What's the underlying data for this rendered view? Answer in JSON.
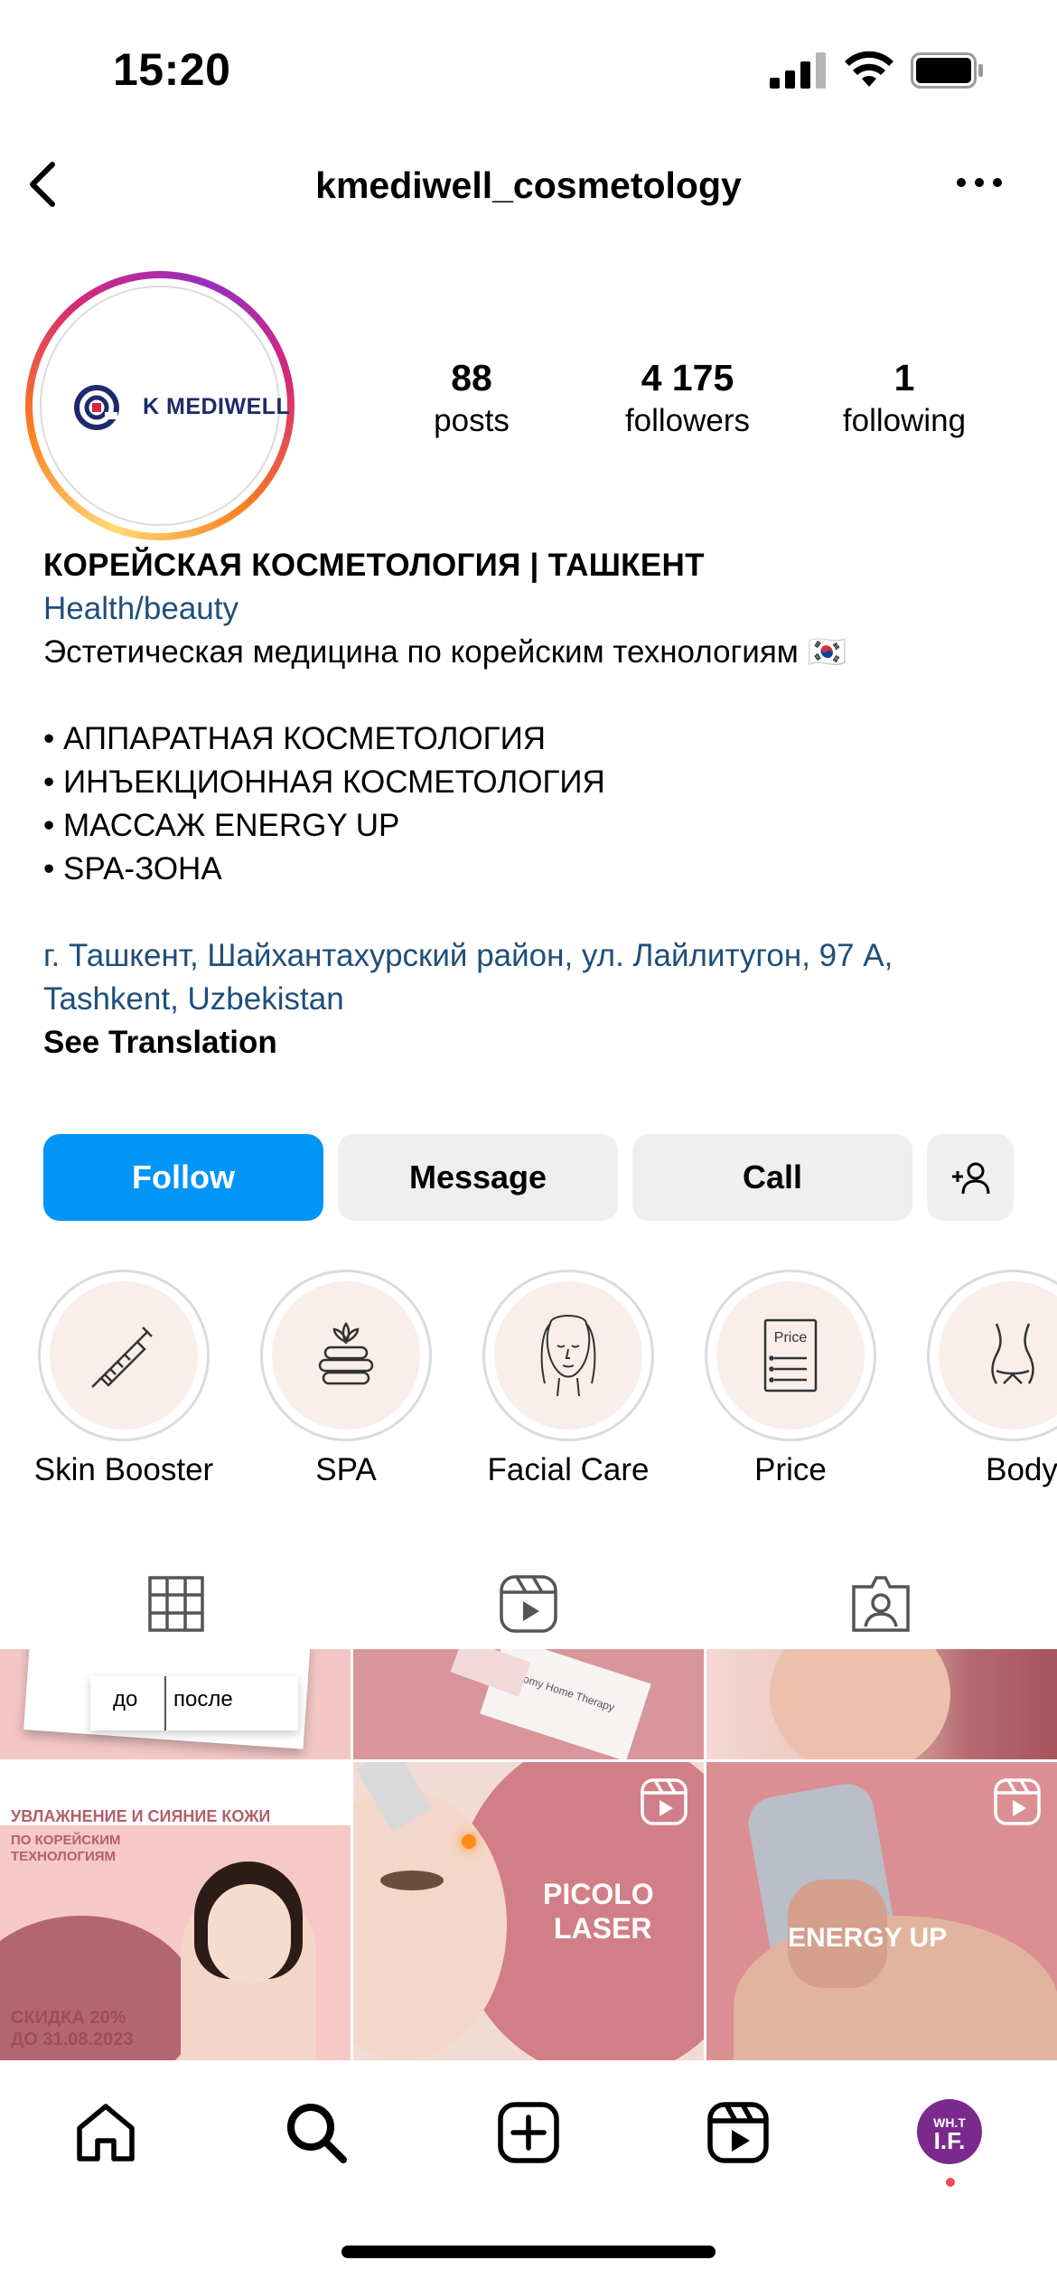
{
  "status_bar": {
    "time": "15:20"
  },
  "header": {
    "username": "kmediwell_cosmetology"
  },
  "profile": {
    "logo_text": "K MEDIWELL",
    "stats": [
      {
        "value": "88",
        "label": "posts"
      },
      {
        "value": "4 175",
        "label": "followers"
      },
      {
        "value": "1",
        "label": "following"
      }
    ],
    "name": "КОРЕЙСКАЯ КОСМЕТОЛОГИЯ | ТАШКЕНТ",
    "category": "Health/beauty",
    "bio_line": "Эстетическая медицина по корейским технологиям 🇰🇷",
    "services": [
      "• АППАРАТНАЯ КОСМЕТОЛОГИЯ",
      "• ИНЪЕКЦИОННАЯ КОСМЕТОЛОГИЯ",
      "• МАССАЖ ENERGY UP",
      "• SPA-ЗОНА"
    ],
    "address_line1": "г. Ташкент, Шайхантахурский район, ул. Лайлитугон, 97 А,",
    "address_line2": "Tashkent, Uzbekistan",
    "see_translation": "See Translation"
  },
  "actions": {
    "follow": "Follow",
    "message": "Message",
    "call": "Call"
  },
  "highlights": [
    {
      "label": "Skin Booster",
      "icon": "syringe-icon"
    },
    {
      "label": "SPA",
      "icon": "spa-stones-icon"
    },
    {
      "label": "Facial Care",
      "icon": "face-icon"
    },
    {
      "label": "Price",
      "icon": "price-list-icon",
      "icon_text": "Price"
    },
    {
      "label": "Body",
      "icon": "body-icon"
    }
  ],
  "tabs": [
    "grid-icon",
    "reels-icon",
    "tagged-icon"
  ],
  "posts": {
    "row1": [
      {
        "labels": [
          "до",
          "после"
        ]
      },
      {
        "card_text": "Atomy Home Therapy"
      },
      {}
    ],
    "row2": [
      {
        "headline": "УВЛАЖНЕНИЕ И СИЯНИЕ КОЖИ",
        "sub": "ПО КОРЕЙСКИМ ТЕХНОЛОГИЯМ",
        "promo1": "СКИДКА 20%",
        "promo2": "ДО 31.08.2023"
      },
      {
        "title1": "PICOLO",
        "title2": "LASER"
      },
      {
        "title": "ENERGY UP"
      }
    ]
  },
  "bottom_nav": {
    "items": [
      "home-icon",
      "search-icon",
      "create-icon",
      "reels-icon",
      "profile-avatar"
    ],
    "avatar_text1": "WH.T",
    "avatar_text2": "I.F."
  },
  "colors": {
    "accent": "#0095f6",
    "link": "#1f4f7a",
    "highlight_bg": "#f9eeea",
    "post_pink": "#e8a3a6"
  }
}
